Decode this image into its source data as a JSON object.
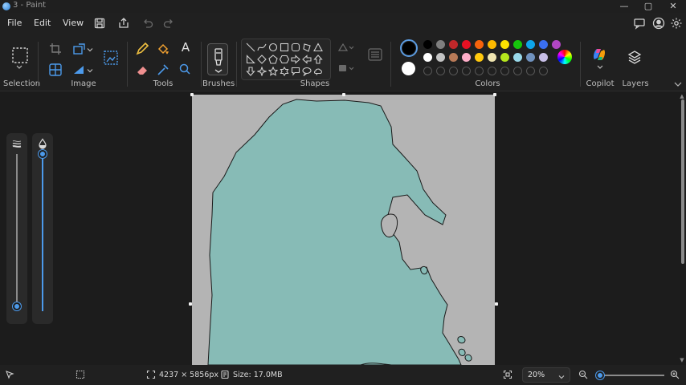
{
  "window": {
    "title": "3 - Paint",
    "controls": {
      "minimize": "—",
      "maximize": "▢",
      "close": "✕"
    }
  },
  "menu": {
    "file": "File",
    "edit": "Edit",
    "view": "View"
  },
  "ribbon": {
    "groups": {
      "selection": "Selection",
      "image": "Image",
      "tools": "Tools",
      "brushes": "Brushes",
      "shapes": "Shapes",
      "colors": "Colors",
      "copilot": "Copilot",
      "layers": "Layers"
    },
    "text_tool_glyph": "A",
    "primary_color": "#000000",
    "secondary_color": "#ffffff",
    "palette_row1": [
      "#000000",
      "#7f7f7f",
      "#c0282a",
      "#e81123",
      "#f7630c",
      "#fcb900",
      "#fce100",
      "#16c60c",
      "#0ea5e9",
      "#3a6ff0",
      "#b146c2"
    ],
    "palette_row2": [
      "#ffffff",
      "#c3c3c3",
      "#b97a57",
      "#ffaec9",
      "#ffc90e",
      "#efe4b0",
      "#b5e61d",
      "#99d9ea",
      "#7092be",
      "#c8bfe7"
    ]
  },
  "canvas": {
    "background": "#b4b4b4",
    "shape_fill": "#87bbb6",
    "outline": "#1a1a1a"
  },
  "sliders": {
    "size_level": 0.03,
    "opacity_level": 1.0
  },
  "status": {
    "image_size": "4237 × 5856px",
    "file_size": "Size: 17.0MB",
    "zoom": "20%",
    "zoom_level": 0.05
  }
}
